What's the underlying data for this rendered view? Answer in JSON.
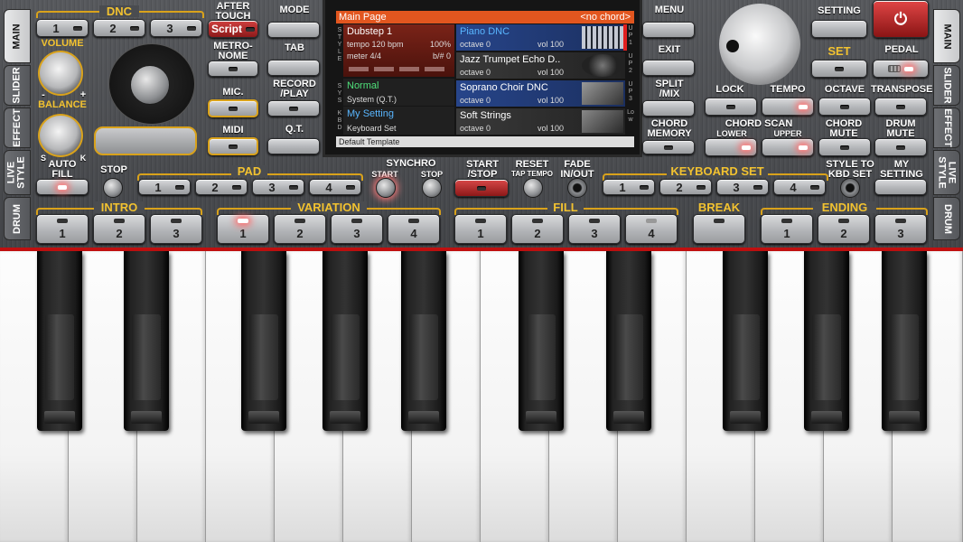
{
  "side_tabs_left": [
    "MAIN",
    "SLIDER",
    "EFFECT",
    "LIVE STYLE",
    "DRUM"
  ],
  "side_tabs_right": [
    "MAIN",
    "SLIDER",
    "EFFECT",
    "LIVE STYLE",
    "DRUM"
  ],
  "dnc": {
    "label": "DNC",
    "buttons": [
      "1",
      "2",
      "3"
    ]
  },
  "after_touch": {
    "label": "AFTER TOUCH",
    "button": "Script"
  },
  "metronome": {
    "label": "METRO-NOME"
  },
  "mic": {
    "label": "MIC."
  },
  "midi": {
    "label": "MIDI"
  },
  "volume": {
    "label": "VOLUME",
    "minus": "-",
    "plus": "+"
  },
  "balance": {
    "label": "BALANCE",
    "s": "S",
    "k": "K"
  },
  "auto_fill": {
    "label": "AUTO FILL"
  },
  "stop": {
    "label": "STOP"
  },
  "pad": {
    "label": "PAD",
    "buttons": [
      "1",
      "2",
      "3",
      "4"
    ]
  },
  "synchro": {
    "label": "SYNCHRO",
    "start": "START",
    "stop": "STOP"
  },
  "start_stop": {
    "label": "START /STOP"
  },
  "reset": {
    "label": "RESET",
    "sub": "TAP TEMPO"
  },
  "fade": {
    "label": "FADE IN/OUT"
  },
  "keyboard_set": {
    "label": "KEYBOARD SET",
    "buttons": [
      "1",
      "2",
      "3",
      "4"
    ]
  },
  "style_to_kbd": {
    "label": "STYLE TO KBD SET"
  },
  "my_setting": {
    "label": "MY SETTING"
  },
  "left_menu": {
    "mode": "MODE",
    "tab": "TAB",
    "record": "RECORD /PLAY",
    "qt": "Q.T."
  },
  "right_menu": {
    "menu": "MENU",
    "exit": "EXIT",
    "split": "SPLIT /MIX",
    "chord_memory": "CHORD MEMORY"
  },
  "setting": {
    "label": "SETTING"
  },
  "set": {
    "label": "SET"
  },
  "pedal": {
    "label": "PEDAL"
  },
  "lock": {
    "label": "LOCK"
  },
  "tempo": {
    "label": "TEMPO"
  },
  "octave": {
    "label": "OCTAVE"
  },
  "transpose": {
    "label": "TRANSPOSE"
  },
  "chord_scan": {
    "label": "CHORD SCAN",
    "lower": "LOWER",
    "upper": "UPPER"
  },
  "chord_mute": {
    "label": "CHORD MUTE"
  },
  "drum_mute": {
    "label": "DRUM MUTE"
  },
  "intro": {
    "label": "INTRO",
    "buttons": [
      "1",
      "2",
      "3"
    ]
  },
  "variation": {
    "label": "VARIATION",
    "buttons": [
      "1",
      "2",
      "3",
      "4"
    ]
  },
  "fill": {
    "label": "FILL",
    "buttons": [
      "1",
      "2",
      "3",
      "4"
    ]
  },
  "break": {
    "label": "BREAK"
  },
  "ending": {
    "label": "ENDING",
    "buttons": [
      "1",
      "2",
      "3"
    ]
  },
  "screen": {
    "header": "Main Page",
    "chord": "<no chord>",
    "style": {
      "name": "Dubstep 1",
      "tempo": "tempo 120 bpm",
      "percent": "100%",
      "meter": "meter 4/4",
      "bpos": "b/# 0",
      "side": "STYLE"
    },
    "sys": {
      "name": "Normal",
      "sub": "System (Q.T.)",
      "side": "SYS"
    },
    "kbd": {
      "name": "My Setting",
      "sub": "Keyboard Set",
      "side": "KBD"
    },
    "up1": {
      "name": "Piano DNC",
      "octave": "octave 0",
      "vol": "vol 100",
      "side": "UP1"
    },
    "up2": {
      "name": "Jazz Trumpet Echo D..",
      "octave": "octave 0",
      "vol": "vol 100",
      "side": "UP2"
    },
    "up3": {
      "name": "Soprano Choir DNC",
      "octave": "octave 0",
      "vol": "vol 100",
      "side": "UP3"
    },
    "low": {
      "name": "Soft Strings",
      "octave": "octave 0",
      "vol": "vol 100",
      "side": "Low"
    },
    "footer": "Default Template"
  },
  "colors": {
    "accent": "#d9a21b",
    "red": "#c01010",
    "screen_header": "#e2561f",
    "blue_cell": "#24407a",
    "red_cell": "#6a1b14"
  }
}
